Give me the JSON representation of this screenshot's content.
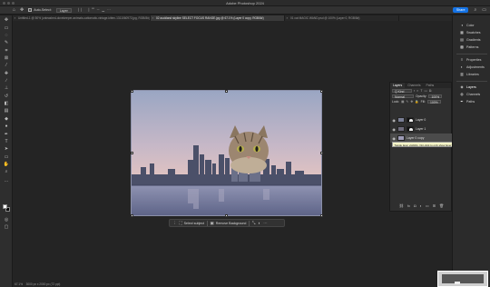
{
  "window": {
    "title": "Adobe Photoshop 2024"
  },
  "options_bar": {
    "auto_select_label": "Auto-Select:",
    "auto_select_value": "Layer",
    "share_label": "Share"
  },
  "tabs": [
    {
      "label": "Untitled-1 @ 50% (unleashed-dovekeeper-animals-cattomatic-vintage-kitten-1311060972.jpg, RGB/8#)",
      "active": false
    },
    {
      "label": "02 auckland skyline SELECT FOCUS RANGE.jpg @ 67.1% (Layer 0 copy, RGB/8#)",
      "active": true
    },
    {
      "label": "01 cat MAGIC WAND.psd @ 100% (Layer 0, RGB/8#)",
      "active": false
    }
  ],
  "dock": {
    "group1": [
      "Color",
      "Swatches",
      "Gradients",
      "Patterns"
    ],
    "group2": [
      "Properties",
      "Adjustments",
      "Libraries"
    ],
    "group3": [
      "Layers",
      "Channels",
      "Paths"
    ]
  },
  "layers_panel": {
    "tabs": [
      "Layers",
      "Channels",
      "Paths"
    ],
    "kind_label": "Q Kind",
    "blend_mode": "Normal",
    "opacity_label": "Opacity:",
    "opacity_value": "100%",
    "lock_label": "Lock:",
    "fill_label": "Fill:",
    "fill_value": "100%",
    "layers": [
      {
        "name": "Layer 0",
        "selected": false
      },
      {
        "name": "Layer 1",
        "selected": false
      },
      {
        "name": "Layer 0 copy",
        "selected": true
      }
    ],
    "tooltip": "Toggle layer visibility. Opt-click to only show layer."
  },
  "context_bar": {
    "select_subject": "Select subject",
    "remove_background": "Remove Background"
  },
  "status": {
    "zoom": "67.1%",
    "doc_info": "3000 px x 2000 px (72 ppi)"
  },
  "colors": {
    "accent": "#1473e6",
    "canvas_bg": "#242424",
    "tooltip_bg": "#f5f5c8"
  }
}
